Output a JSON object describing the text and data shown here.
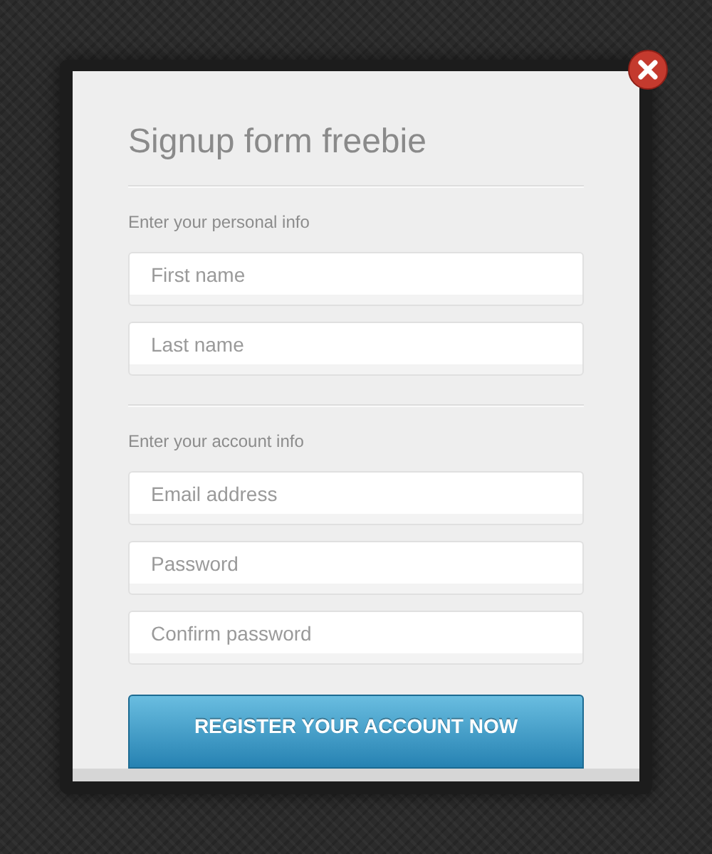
{
  "title": "Signup form freebie",
  "sections": [
    {
      "label": "Enter your personal info",
      "fields": [
        {
          "placeholder": "First name"
        },
        {
          "placeholder": "Last name"
        }
      ]
    },
    {
      "label": "Enter your account info",
      "fields": [
        {
          "placeholder": "Email address"
        },
        {
          "placeholder": "Password"
        },
        {
          "placeholder": "Confirm password"
        }
      ]
    }
  ],
  "submit_button": "REGISTER YOUR ACCOUNT NOW"
}
